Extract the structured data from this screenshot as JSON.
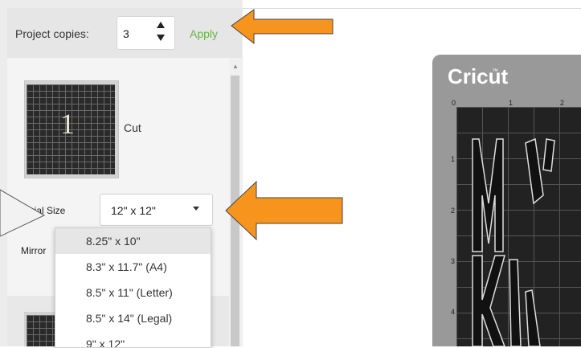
{
  "left_panel": {
    "copies_label": "Project copies:",
    "copies_value": "3",
    "apply_label": "Apply",
    "mat_number": "1",
    "cut_label": "Cut",
    "material_size_label": "erial Size",
    "material_size_value": "12\" x 12\"",
    "mirror_label": "Mirror"
  },
  "dropdown": {
    "options": [
      "8.25\" x 10\"",
      "8.3\" x 11.7\" (A4)",
      "8.5\" x 11\" (Letter)",
      "8.5\" x 14\" (Legal)",
      "9\" x 12\""
    ],
    "selected": "8.25\" x 10\""
  },
  "preview": {
    "brand": "Cricut",
    "ruler_top": [
      "0",
      "1",
      "2"
    ],
    "ruler_left": [
      "1",
      "2",
      "3",
      "4"
    ]
  },
  "colors": {
    "accent_arrow": "#f7941d",
    "apply_green": "#6ab04c",
    "mat_gray": "#999999"
  }
}
